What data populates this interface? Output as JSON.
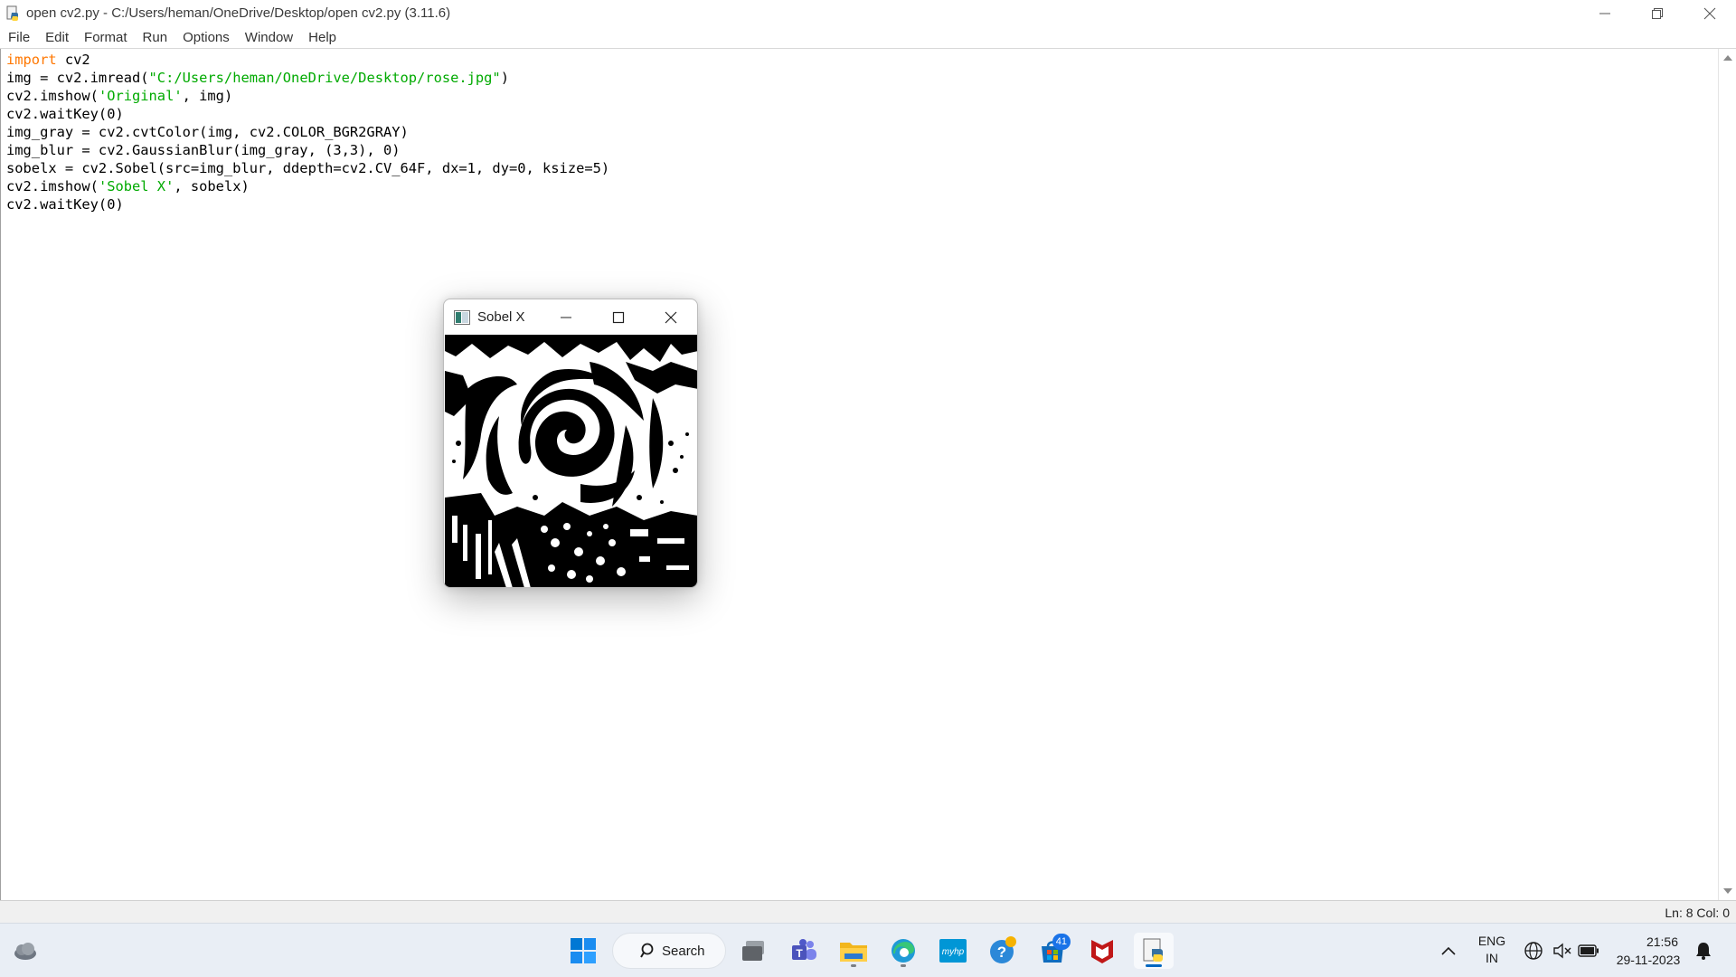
{
  "window": {
    "title": "open cv2.py - C:/Users/heman/OneDrive/Desktop/open cv2.py (3.11.6)"
  },
  "menu": [
    "File",
    "Edit",
    "Format",
    "Run",
    "Options",
    "Window",
    "Help"
  ],
  "code_lines": [
    [
      {
        "t": "import",
        "c": "kw"
      },
      {
        "t": " cv2"
      }
    ],
    [
      {
        "t": "img = cv2.imread("
      },
      {
        "t": "\"C:/Users/heman/OneDrive/Desktop/rose.jpg\"",
        "c": "str"
      },
      {
        "t": ")"
      }
    ],
    [
      {
        "t": "cv2.imshow("
      },
      {
        "t": "'Original'",
        "c": "str"
      },
      {
        "t": ", img)"
      }
    ],
    [
      {
        "t": "cv2.waitKey(0)"
      }
    ],
    [
      {
        "t": "img_gray = cv2.cvtColor(img, cv2.COLOR_BGR2GRAY)"
      }
    ],
    [
      {
        "t": "img_blur = cv2.GaussianBlur(img_gray, (3,3), 0)"
      }
    ],
    [
      {
        "t": "sobelx = cv2.Sobel(src=img_blur, ddepth=cv2.CV_64F, dx=1, dy=0, ksize=5)"
      }
    ],
    [
      {
        "t": "cv2.imshow("
      },
      {
        "t": "'Sobel X'",
        "c": "str"
      },
      {
        "t": ", sobelx)"
      }
    ],
    [
      {
        "t": "cv2.waitKey(0)"
      }
    ]
  ],
  "status": {
    "position": "Ln: 8   Col: 0"
  },
  "cv_window": {
    "title": "Sobel X",
    "image_description_icon": "rose-edge-image"
  },
  "taskbar": {
    "search_label": "Search",
    "store_badge": "41",
    "lang_line1": "ENG",
    "lang_line2": "IN",
    "time": "21:56",
    "date": "29-11-2023",
    "icons": [
      "weather-icon",
      "windows-start-icon",
      "search-icon",
      "task-view-icon",
      "teams-icon",
      "file-explorer-icon",
      "edge-icon",
      "myhp-icon",
      "get-help-icon",
      "store-icon",
      "mcafee-icon",
      "python-idle-icon",
      "chevron-up-icon",
      "language-icon",
      "network-icon",
      "volume-muted-icon",
      "battery-icon",
      "notification-bell-icon"
    ]
  },
  "colors": {
    "keyword": "#ff7700",
    "string": "#00aa00",
    "accent": "#0067c0"
  }
}
